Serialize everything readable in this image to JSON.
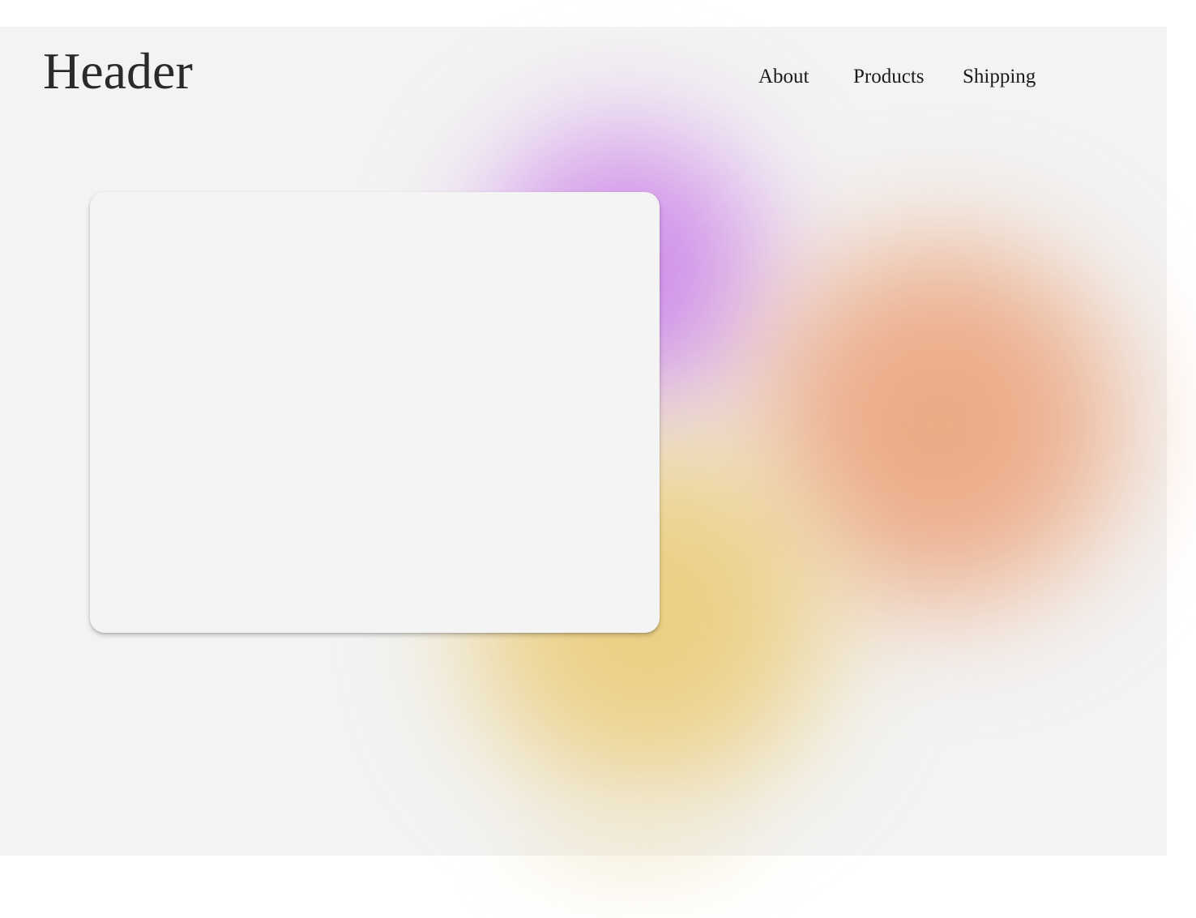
{
  "header": {
    "title": "Header"
  },
  "nav": {
    "items": [
      {
        "label": "About"
      },
      {
        "label": "Products"
      },
      {
        "label": "Shipping"
      }
    ]
  },
  "theme": {
    "background": "#f3f3f3",
    "card_background": "#f4f4f4",
    "blob_colors": {
      "purple": "#c878e6",
      "orange": "#eaa078",
      "yellow": "#e9c86e"
    }
  }
}
